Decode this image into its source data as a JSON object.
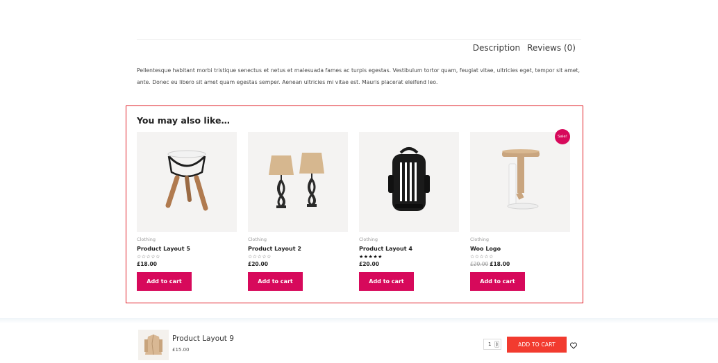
{
  "tabs": {
    "description": "Description",
    "reviews": "Reviews (0)"
  },
  "description_text": "Pellentesque habitant morbi tristique senectus et netus et malesuada fames ac turpis egestas. Vestibulum tortor quam, feugiat vitae, ultricies eget, tempor sit amet, ante. Donec eu libero sit amet quam egestas semper. Aenean ultricies mi vitae est. Mauris placerat eleifend leo.",
  "related": {
    "heading": "You may also like…",
    "products": [
      {
        "category": "Clothing",
        "title": "Product Layout 5",
        "stars": "☆☆☆☆☆",
        "price": "£18.00",
        "button": "Add to cart"
      },
      {
        "category": "Clothing",
        "title": "Product Layout 2",
        "stars": "☆☆☆☆☆",
        "price": "£20.00",
        "button": "Add to cart"
      },
      {
        "category": "Clothing",
        "title": "Product Layout 4",
        "stars": "★★★★★",
        "price": "£20.00",
        "button": "Add to cart"
      },
      {
        "category": "Clothing",
        "title": "Woo Logo",
        "stars": "☆☆☆☆☆",
        "old_price": "£20.00",
        "price": "£18.00",
        "button": "Add to cart",
        "badge": "Sale!"
      }
    ]
  },
  "sticky": {
    "name": "Product Layout 9",
    "price": "£15.00",
    "qty": "1",
    "add_label": "ADD TO CART"
  },
  "colors": {
    "accent": "#d7095b",
    "sticky_button": "#f23b2f",
    "highlight_border": "#e01b24"
  },
  "icons": [
    "heart-icon"
  ]
}
